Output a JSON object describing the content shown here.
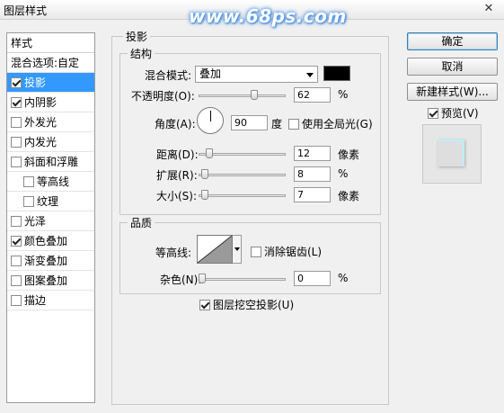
{
  "window": {
    "title": "图层样式",
    "watermark": "www.68ps.com",
    "close": "✕"
  },
  "style_list": {
    "header": "样式",
    "blend_options": "混合选项:自定",
    "items": [
      {
        "label": "投影",
        "checked": true,
        "selected": true
      },
      {
        "label": "内阴影",
        "checked": true
      },
      {
        "label": "外发光",
        "checked": false
      },
      {
        "label": "内发光",
        "checked": false
      },
      {
        "label": "斜面和浮雕",
        "checked": false
      },
      {
        "label": "等高线",
        "checked": false,
        "sub": true
      },
      {
        "label": "纹理",
        "checked": false,
        "sub": true
      },
      {
        "label": "光泽",
        "checked": false
      },
      {
        "label": "颜色叠加",
        "checked": true
      },
      {
        "label": "渐变叠加",
        "checked": false
      },
      {
        "label": "图案叠加",
        "checked": false
      },
      {
        "label": "描边",
        "checked": false
      }
    ]
  },
  "panel": {
    "title": "投影",
    "structure": {
      "title": "结构",
      "blend_mode_label": "混合模式:",
      "blend_mode_value": "叠加",
      "color": "#000000",
      "opacity_label": "不透明度(O):",
      "opacity_value": "62",
      "opacity_unit": "%",
      "angle_label": "角度(A):",
      "angle_value": "90",
      "angle_unit": "度",
      "global_light_label": "使用全局光(G)",
      "distance_label": "距离(D):",
      "distance_value": "12",
      "distance_unit": "像素",
      "spread_label": "扩展(R):",
      "spread_value": "8",
      "spread_unit": "%",
      "size_label": "大小(S):",
      "size_value": "7",
      "size_unit": "像素"
    },
    "quality": {
      "title": "品质",
      "contour_label": "等高线:",
      "antialias_label": "消除锯齿(L)",
      "noise_label": "杂色(N):",
      "noise_value": "0",
      "noise_unit": "%"
    },
    "knockout_label": "图层挖空投影(U)"
  },
  "buttons": {
    "ok": "确定",
    "cancel": "取消",
    "new_style": "新建样式(W)...",
    "preview_label": "预览(V)"
  }
}
